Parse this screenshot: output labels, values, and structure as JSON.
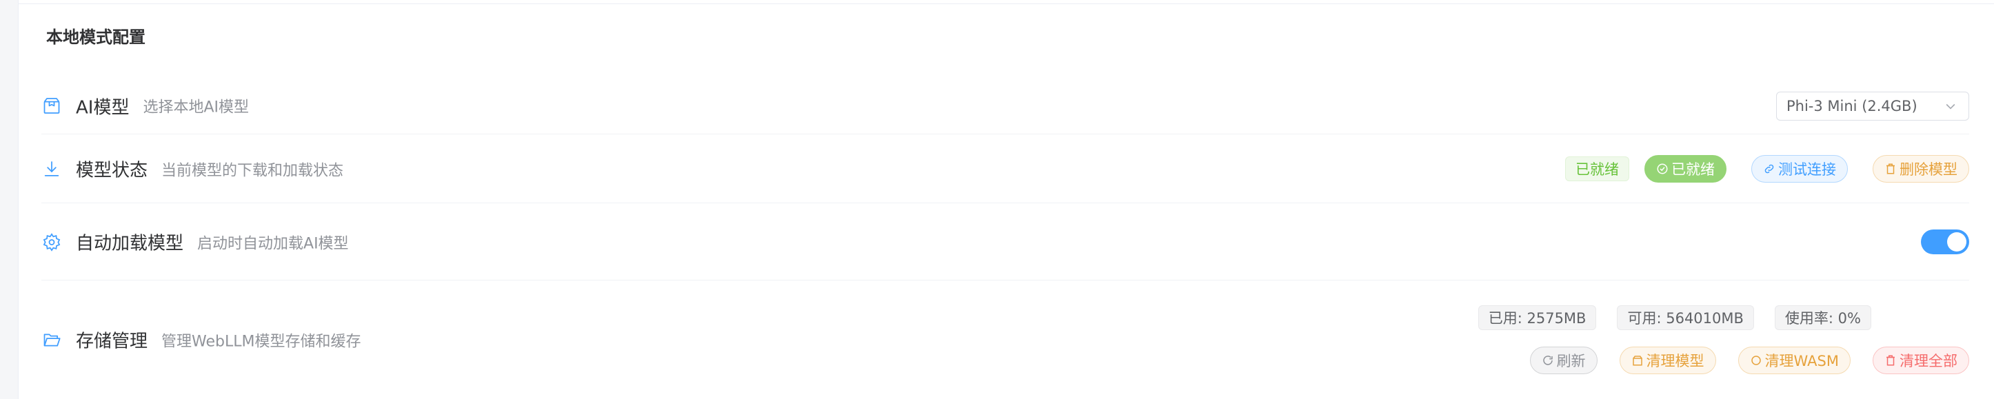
{
  "section": {
    "title": "本地模式配置"
  },
  "rows": {
    "model": {
      "icon": "package-icon",
      "title": "AI模型",
      "desc": "选择本地AI模型",
      "select_value": "Phi-3 Mini (2.4GB)"
    },
    "status": {
      "icon": "download-icon",
      "title": "模型状态",
      "desc": "当前模型的下载和加载状态",
      "tag": "已就绪",
      "ready_button": "已就绪",
      "test_button": "测试连接",
      "delete_button": "删除模型"
    },
    "autoload": {
      "icon": "gear-icon",
      "title": "自动加载模型",
      "desc": "启动时自动加载AI模型",
      "enabled": true
    },
    "storage": {
      "icon": "folder-open-icon",
      "title": "存储管理",
      "desc": "管理WebLLM模型存储和缓存",
      "used": "已用: 2575MB",
      "available": "可用: 564010MB",
      "usage": "使用率: 0%",
      "refresh_button": "刷新",
      "clear_models_button": "清理模型",
      "clear_wasm_button": "清理WASM",
      "clear_all_button": "清理全部"
    }
  },
  "colors": {
    "primary": "#409eff",
    "success": "#67c23a",
    "warning": "#e6a23c",
    "danger": "#f56c6c",
    "info": "#909399"
  }
}
